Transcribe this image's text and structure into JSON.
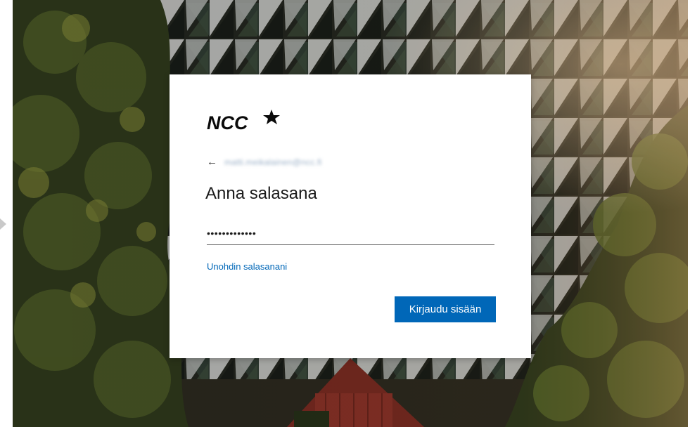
{
  "login": {
    "brand": "NCC",
    "back_icon": "arrow-left-icon",
    "identity": "matti.meikalainen@ncc.fi",
    "heading": "Anna salasana",
    "password_masked": "•••••••••••••",
    "forgot_link": "Unohdin salasanani",
    "signin_label": "Kirjaudu sisään"
  },
  "colors": {
    "accent": "#0067b8",
    "heading": "#1b1b1b",
    "card": "#ffffff"
  }
}
